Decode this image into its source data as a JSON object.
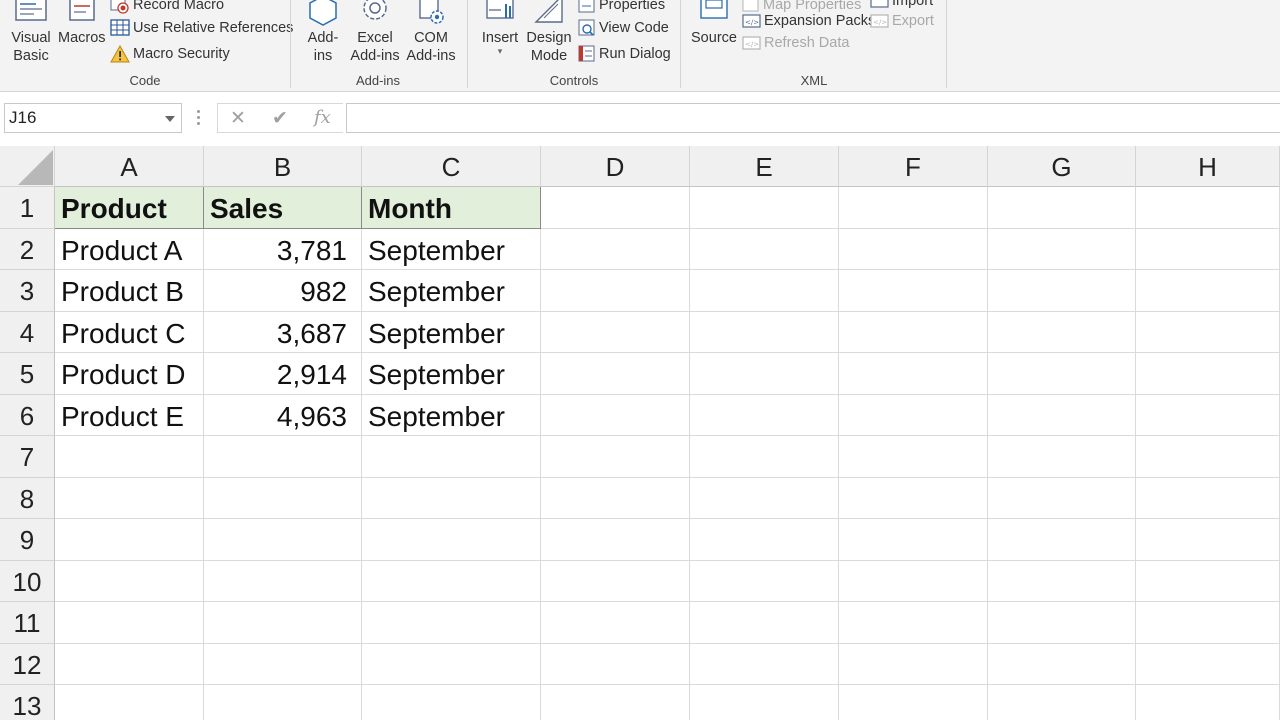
{
  "ribbon": {
    "code_group": {
      "label": "Code",
      "visual_basic": "Visual\nBasic",
      "macros": "Macros",
      "record_macro": "Record Macro",
      "use_relative_references": "Use Relative References",
      "macro_security": "Macro Security"
    },
    "addins_group": {
      "label": "Add-ins",
      "addins": "Add-\nins",
      "excel_addins": "Excel\nAdd-ins",
      "com_addins": "COM\nAdd-ins"
    },
    "controls_group": {
      "label": "Controls",
      "insert": "Insert",
      "design_mode": "Design\nMode",
      "properties": "Properties",
      "view_code": "View Code",
      "run_dialog": "Run Dialog"
    },
    "xml_group": {
      "label": "XML",
      "source": "Source",
      "map_properties": "Map Properties",
      "expansion_packs": "Expansion Packs",
      "refresh_data": "Refresh Data",
      "import": "Import",
      "export": "Export"
    }
  },
  "formula_bar": {
    "name_box": "J16",
    "fx": "fx",
    "formula": ""
  },
  "sheet": {
    "columns": [
      "A",
      "B",
      "C",
      "D",
      "E",
      "F",
      "G",
      "H"
    ],
    "rows": [
      "1",
      "2",
      "3",
      "4",
      "5",
      "6",
      "7",
      "8",
      "9",
      "10",
      "11",
      "12",
      "13"
    ],
    "header": [
      "Product",
      "Sales",
      "Month"
    ],
    "data": [
      [
        "Product A",
        "3,781",
        "September"
      ],
      [
        "Product B",
        "982",
        "September"
      ],
      [
        "Product C",
        "3,687",
        "September"
      ],
      [
        "Product D",
        "2,914",
        "September"
      ],
      [
        "Product E",
        "4,963",
        "September"
      ]
    ]
  },
  "colors": {
    "header_fill": "#e2efda",
    "ribbon_bg": "#f3f3f3"
  }
}
